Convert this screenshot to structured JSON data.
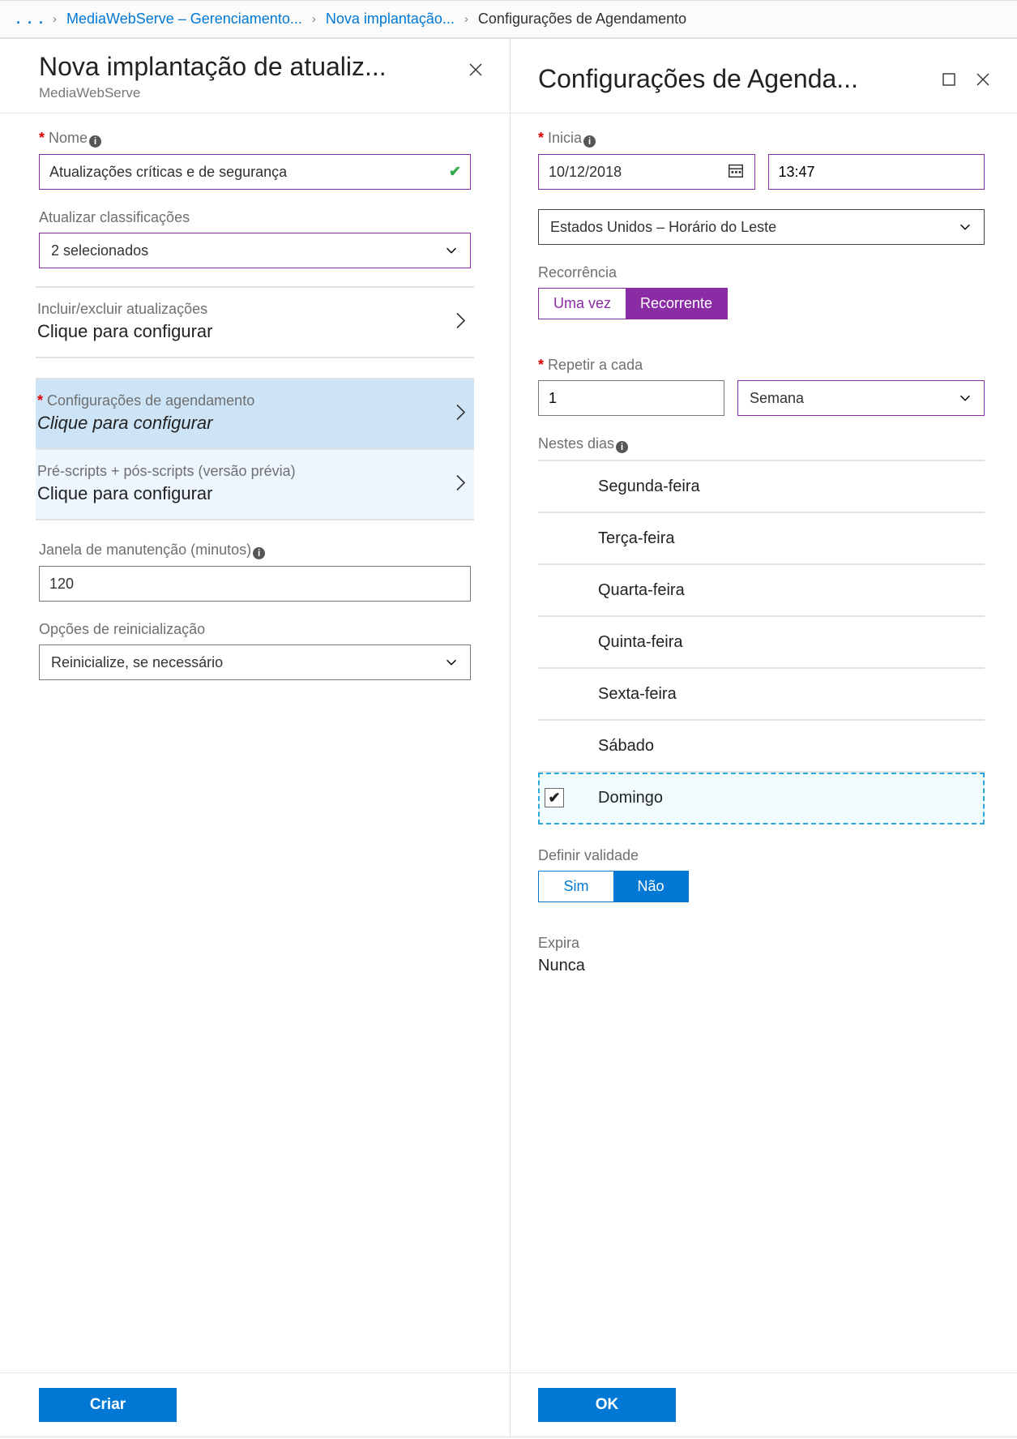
{
  "breadcrumb": {
    "dots": ". . .",
    "items": [
      {
        "label": "MediaWebServe – Gerenciamento..."
      },
      {
        "label": "Nova implantação..."
      }
    ],
    "current": "Configurações de Agendamento"
  },
  "left": {
    "title": "Nova implantação de atualiz...",
    "subtitle": "MediaWebServe",
    "name_label": "Nome",
    "name_value": "Atualizações críticas e de segurança",
    "classifications_label": "Atualizar classificações",
    "classifications_value": "2 selecionados",
    "items": [
      {
        "title": "Incluir/excluir atualizações",
        "action": "Clique para configurar",
        "required": false
      },
      {
        "title": "Configurações de agendamento",
        "action": "Clique para configurar",
        "required": true
      },
      {
        "title": "Pré-scripts + pós-scripts (versão prévia)",
        "action": "Clique para configurar",
        "required": false
      }
    ],
    "maint_label": "Janela de manutenção (minutos)",
    "maint_value": "120",
    "reboot_label": "Opções de reinicialização",
    "reboot_value": "Reinicialize, se necessário",
    "create_btn": "Criar"
  },
  "right": {
    "title": "Configurações de Agenda...",
    "start_label": "Inicia",
    "start_date": "10/12/2018",
    "start_time": "13:47",
    "timezone": "Estados Unidos – Horário do Leste",
    "recurrence_label": "Recorrência",
    "recurrence_opts": {
      "once": "Uma vez",
      "recurrent": "Recorrente"
    },
    "repeat_label": "Repetir a cada",
    "repeat_value": "1",
    "repeat_unit": "Semana",
    "days_label": "Nestes dias",
    "days": [
      {
        "label": "Segunda-feira",
        "checked": false
      },
      {
        "label": "Terça-feira",
        "checked": false
      },
      {
        "label": "Quarta-feira",
        "checked": false
      },
      {
        "label": "Quinta-feira",
        "checked": false
      },
      {
        "label": "Sexta-feira",
        "checked": false
      },
      {
        "label": "Sábado",
        "checked": false
      },
      {
        "label": "Domingo",
        "checked": true
      }
    ],
    "expiry_set_label": "Definir validade",
    "expiry_opts": {
      "yes": "Sim",
      "no": "Não"
    },
    "expires_label": "Expira",
    "expires_value": "Nunca",
    "ok_btn": "OK"
  }
}
